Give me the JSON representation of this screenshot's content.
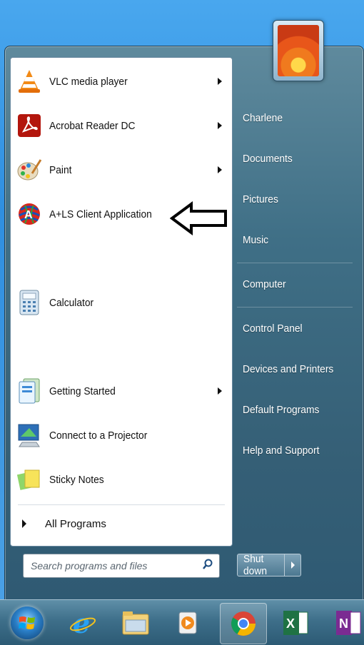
{
  "programs": [
    {
      "label": "VLC media player",
      "icon": "vlc-icon",
      "submenu": true
    },
    {
      "label": "Acrobat Reader DC",
      "icon": "acrobat-icon",
      "submenu": true
    },
    {
      "label": "Paint",
      "icon": "paint-icon",
      "submenu": true
    },
    {
      "label": "A+LS Client Application",
      "icon": "als-client-icon",
      "submenu": false
    },
    {
      "label": "Calculator",
      "icon": "calculator-icon",
      "submenu": false
    },
    {
      "label": "Getting Started",
      "icon": "getting-started-icon",
      "submenu": true
    },
    {
      "label": "Connect to a Projector",
      "icon": "projector-icon",
      "submenu": false
    },
    {
      "label": "Sticky Notes",
      "icon": "sticky-notes-icon",
      "submenu": false
    }
  ],
  "all_programs": "All Programs",
  "search": {
    "placeholder": "Search programs and files"
  },
  "right_items": [
    "Charlene",
    "Documents",
    "Pictures",
    "Music",
    "Computer",
    "Control Panel",
    "Devices and Printers",
    "Default Programs",
    "Help and Support"
  ],
  "shutdown": {
    "label": "Shut down"
  },
  "taskbar": [
    "start-orb",
    "internet-explorer-icon",
    "file-explorer-icon",
    "media-player-icon",
    "chrome-icon",
    "excel-icon",
    "onenote-icon"
  ],
  "colors": {
    "pane": "#ffffff",
    "menu_frame": "#3f6f86",
    "taskbar": "#3e6f8a"
  }
}
